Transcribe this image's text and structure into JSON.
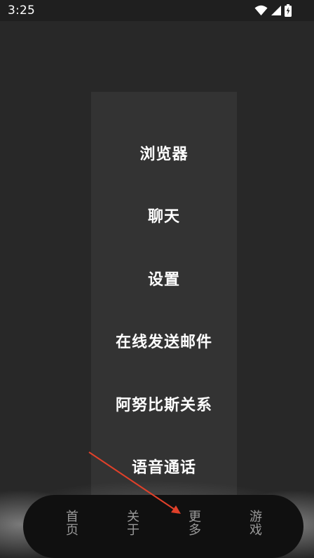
{
  "status_bar": {
    "time": "3:25",
    "icons": [
      "wifi-icon",
      "signal-icon",
      "battery-charging-icon"
    ]
  },
  "menu": {
    "items": [
      {
        "label": "浏览器"
      },
      {
        "label": "聊天"
      },
      {
        "label": "设置"
      },
      {
        "label": "在线发送邮件"
      },
      {
        "label": "阿努比斯关系"
      },
      {
        "label": "语音通话"
      }
    ]
  },
  "bottom_nav": {
    "items": [
      {
        "label": "首页"
      },
      {
        "label": "关于"
      },
      {
        "label": "更多"
      },
      {
        "label": "游戏"
      }
    ]
  },
  "annotation": {
    "arrow_color": "#e0402a"
  }
}
